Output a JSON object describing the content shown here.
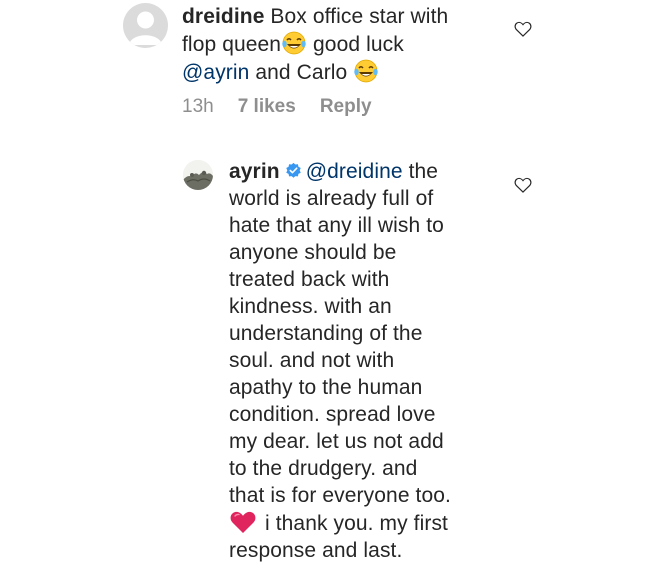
{
  "comment1": {
    "username": "dreidine",
    "lines": [
      "Box office star with",
      "flop queen",
      "good luck",
      "@ayrin",
      "and Carlo"
    ],
    "time": "13h",
    "likes": "7 likes",
    "reply": "Reply",
    "avatar_icon": "default-user-avatar",
    "like_icon": "heart-outline-icon"
  },
  "comment2": {
    "username": "ayrin",
    "mention": "@dreidine",
    "first_line_rest": "the",
    "lines": [
      "world is already full of",
      "hate that any ill wish to",
      "anyone should be",
      "treated back with",
      "kindness. with an",
      "understanding of the",
      "soul. and not with",
      "apathy to the human",
      "condition. spread love",
      "my dear. let us not add",
      "to the drudgery. and",
      "that is for everyone too."
    ],
    "heart_line_rest": "i thank you. my first",
    "last_line": "response and last.",
    "verified_icon": "verified-badge-icon",
    "like_icon": "heart-outline-icon",
    "emoji_heart": "red-heart-emoji"
  },
  "colors": {
    "text": "#262626",
    "mention": "#003569",
    "meta": "#8e8e8e",
    "verified": "#3897f0",
    "heart_emoji": "#e0245e"
  }
}
